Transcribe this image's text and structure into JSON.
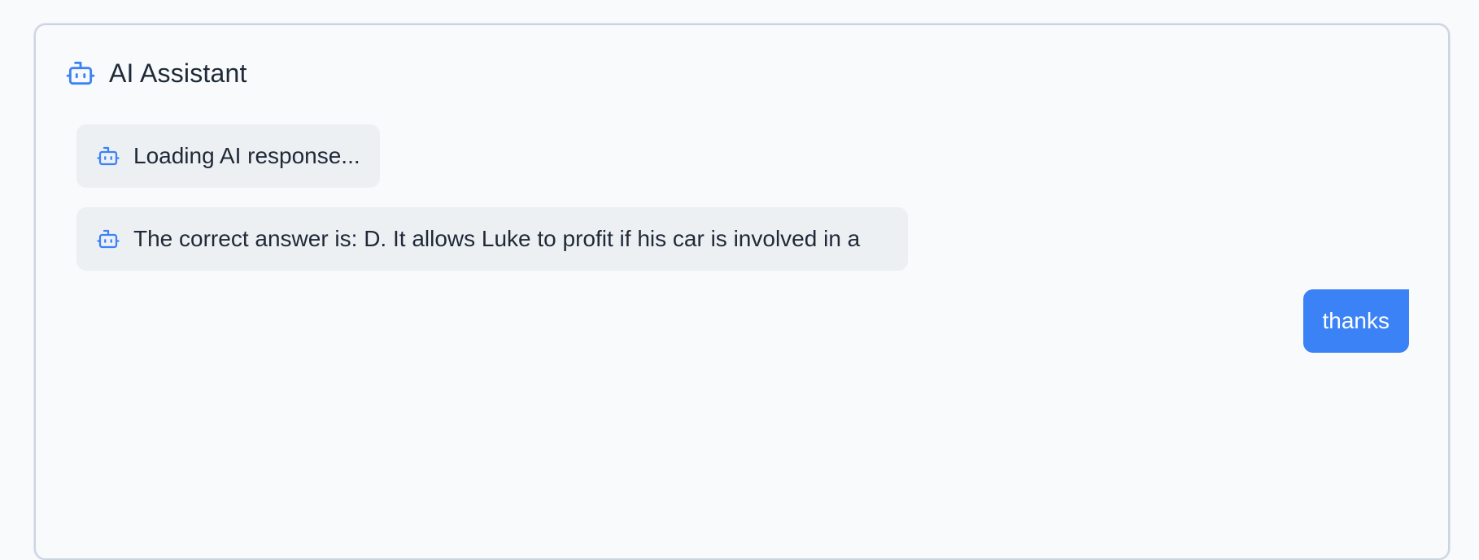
{
  "header": {
    "title": "AI Assistant",
    "icon": "robot-icon"
  },
  "messages": [
    {
      "role": "assistant",
      "icon": "robot-icon",
      "text": "Loading AI response..."
    },
    {
      "role": "assistant",
      "icon": "robot-icon",
      "text": "The correct answer is: D. It allows Luke to profit if his car is involved in a"
    },
    {
      "role": "user",
      "text": "thanks"
    }
  ],
  "colors": {
    "accent": "#3b82f6",
    "assistant_bubble": "#edf0f3",
    "panel_border": "#cbd5e1",
    "background": "#f8fafc"
  }
}
